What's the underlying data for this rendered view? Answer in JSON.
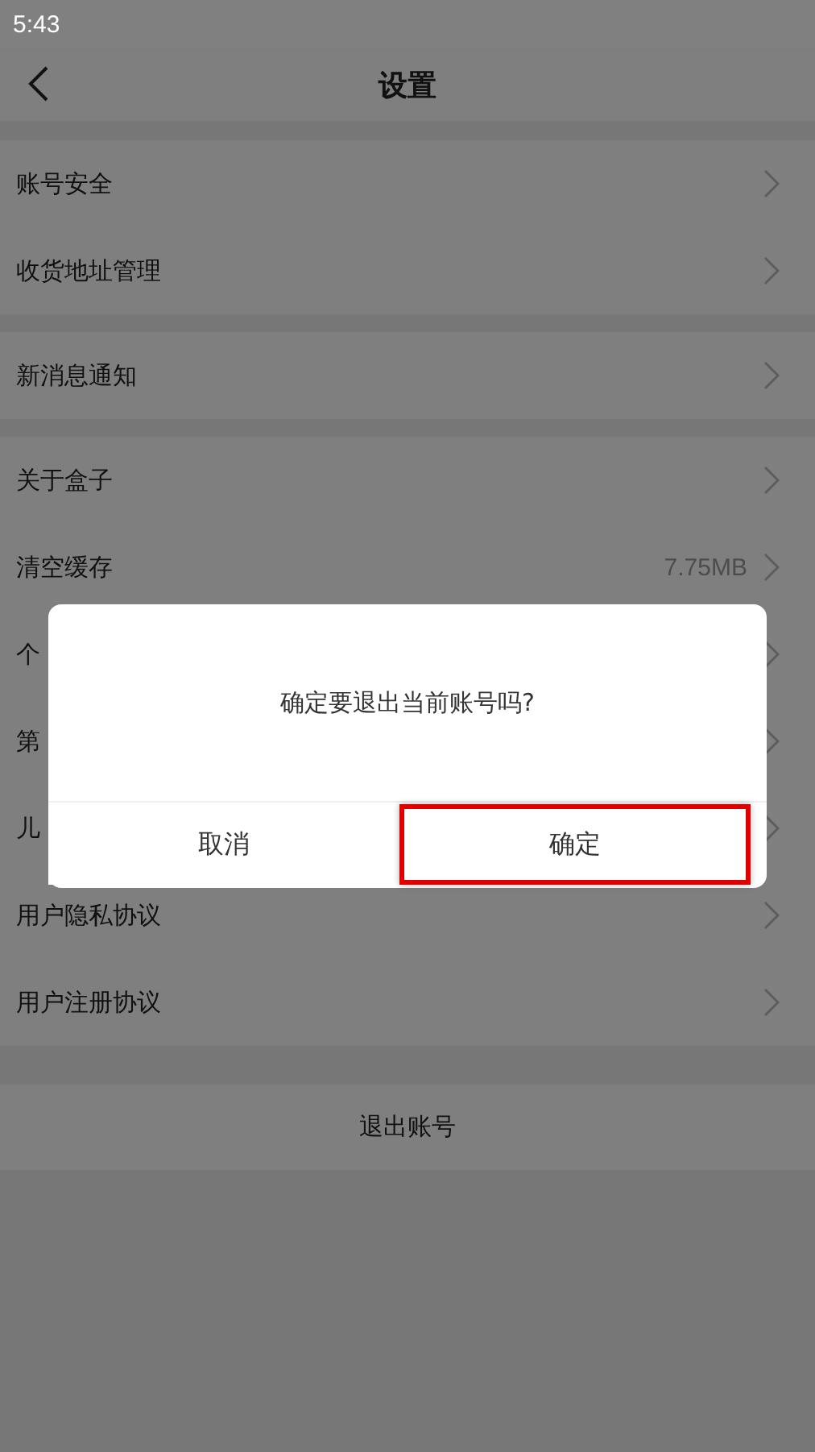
{
  "status_bar": {
    "time": "5:43"
  },
  "header": {
    "title": "设置"
  },
  "sections": [
    {
      "items": [
        {
          "label": "账号安全"
        },
        {
          "label": "收货地址管理"
        }
      ]
    },
    {
      "items": [
        {
          "label": "新消息通知"
        }
      ]
    },
    {
      "items": [
        {
          "label": "关于盒子"
        },
        {
          "label": "清空缓存",
          "value": "7.75MB"
        },
        {
          "label": "个"
        },
        {
          "label": "第"
        },
        {
          "label": "儿"
        },
        {
          "label": "用户隐私协议"
        },
        {
          "label": "用户注册协议"
        }
      ]
    }
  ],
  "logout": {
    "label": "退出账号"
  },
  "dialog": {
    "message": "确定要退出当前账号吗?",
    "buttons": [
      {
        "label": "取消",
        "highlighted": false
      },
      {
        "label": "确定",
        "highlighted": true
      }
    ]
  }
}
